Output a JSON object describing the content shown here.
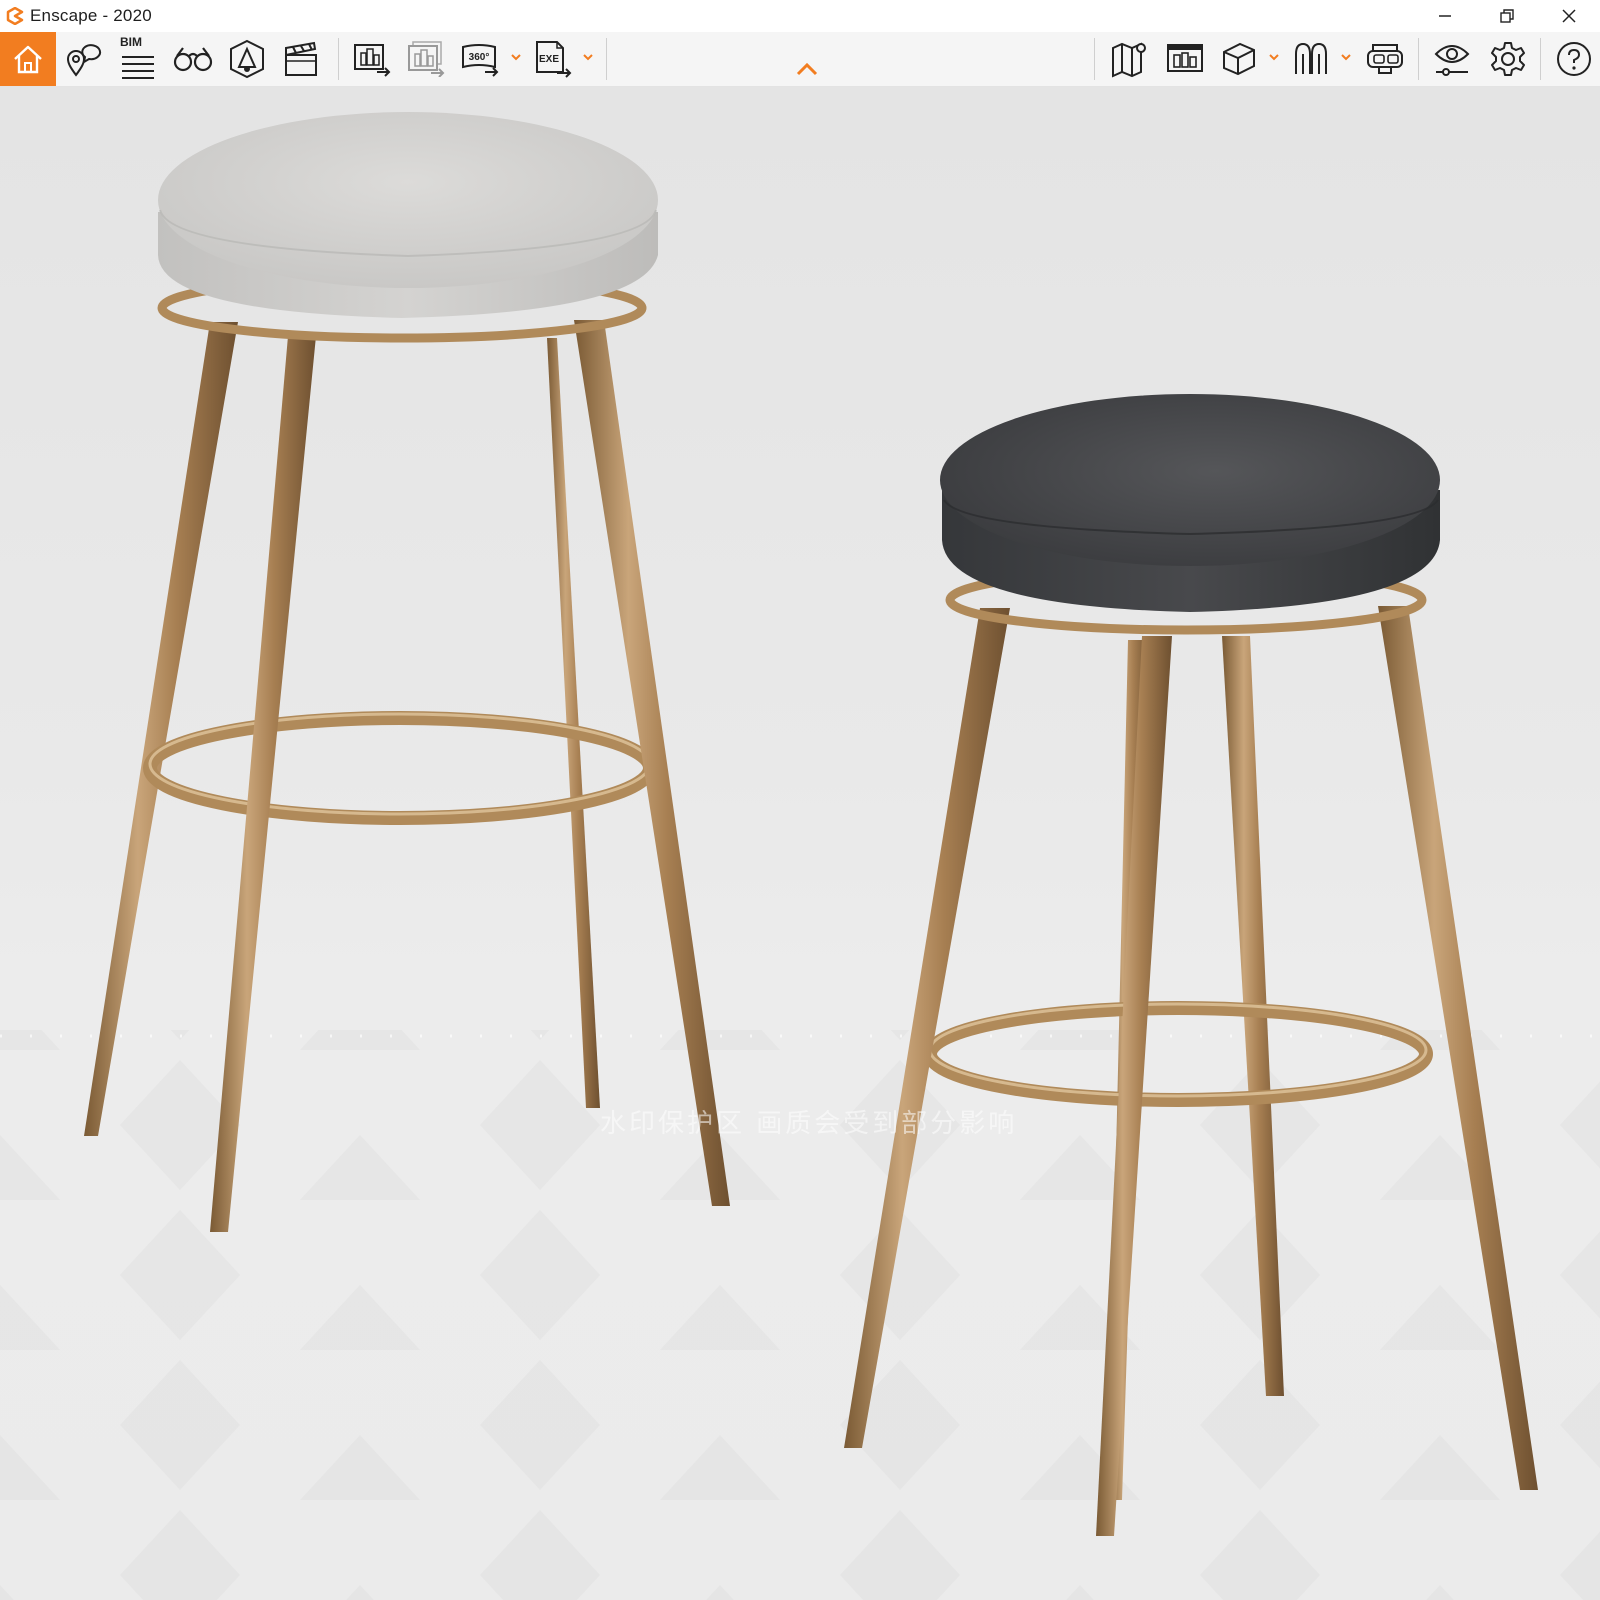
{
  "window": {
    "title": "Enscape - 2020"
  },
  "toolbar": {
    "bim_label": "BIM",
    "left_tools": [
      {
        "icon": "home-icon"
      },
      {
        "icon": "map-pin-chat-icon"
      },
      {
        "icon": "bim-list-icon"
      },
      {
        "icon": "binoculars-icon"
      },
      {
        "icon": "sun-cube-icon"
      },
      {
        "icon": "clapperboard-icon"
      },
      {
        "icon": "render-screenshot-icon"
      },
      {
        "icon": "batch-render-icon"
      },
      {
        "icon": "panorama-360-icon"
      },
      {
        "icon": "export-exe-icon"
      }
    ],
    "right_tools": [
      {
        "icon": "map-icon"
      },
      {
        "icon": "asset-library-icon"
      },
      {
        "icon": "view-cube-icon"
      },
      {
        "icon": "people-icon"
      },
      {
        "icon": "vr-headset-icon"
      },
      {
        "icon": "visual-settings-eye-icon"
      },
      {
        "icon": "settings-gear-icon"
      },
      {
        "icon": "help-icon"
      }
    ],
    "label_360": "360°",
    "label_exe": "EXE"
  },
  "scene": {
    "watermark": "水印保护区  画质会受到部分影响",
    "colors": {
      "accent": "#f27d20",
      "light_seat": "#cfcecc",
      "dark_seat": "#3e3f41",
      "brass": "#b08a5a"
    }
  }
}
